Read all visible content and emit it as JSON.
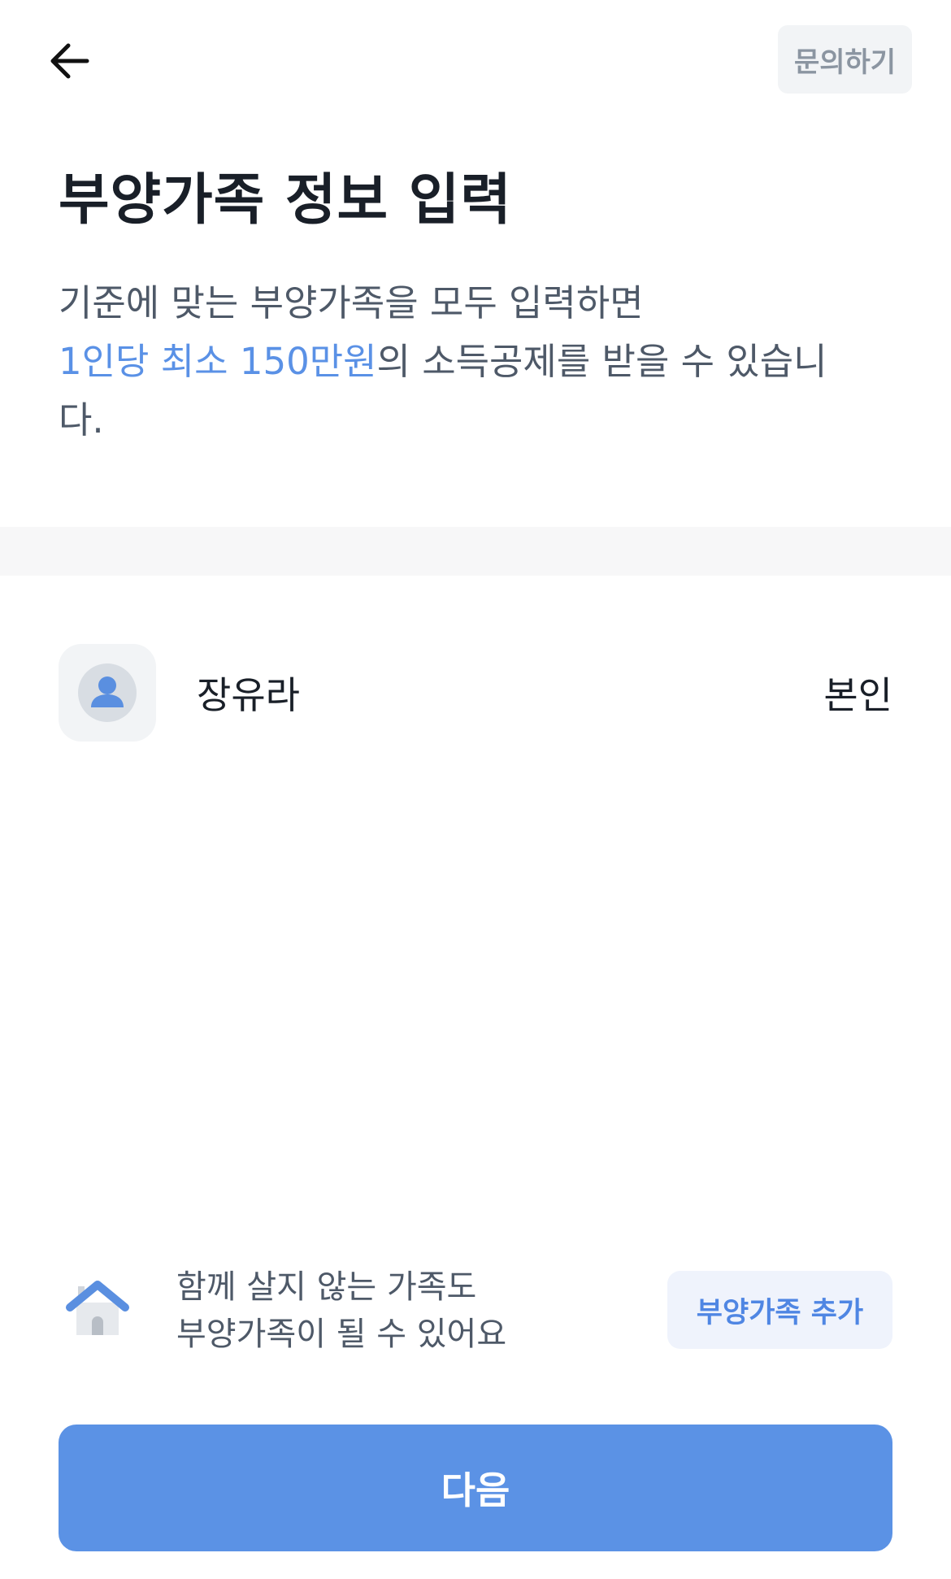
{
  "header": {
    "back_icon": "arrow-left-icon",
    "help_label": "문의하기"
  },
  "title": "부양가족 정보 입력",
  "description": {
    "line1": "기준에 맞는 부양가족을 모두 입력하면",
    "highlight": "1인당 최소 150만원",
    "rest": "의 소득공제를 받을 수 있습니다.",
    "highlight_color": "#5a91e6"
  },
  "members": [
    {
      "name": "장유라",
      "relation": "본인",
      "avatar_icon": "person-avatar-icon"
    }
  ],
  "notice": {
    "icon": "house-icon",
    "line1": "함께 살지 않는 가족도",
    "line2": "부양가족이 될 수 있어요"
  },
  "buttons": {
    "add_label": "부양가족 추가",
    "next_label": "다음"
  },
  "colors": {
    "primary": "#5b92e5",
    "secondary_bg": "#eff3fc",
    "secondary_text": "#4f86e3"
  }
}
